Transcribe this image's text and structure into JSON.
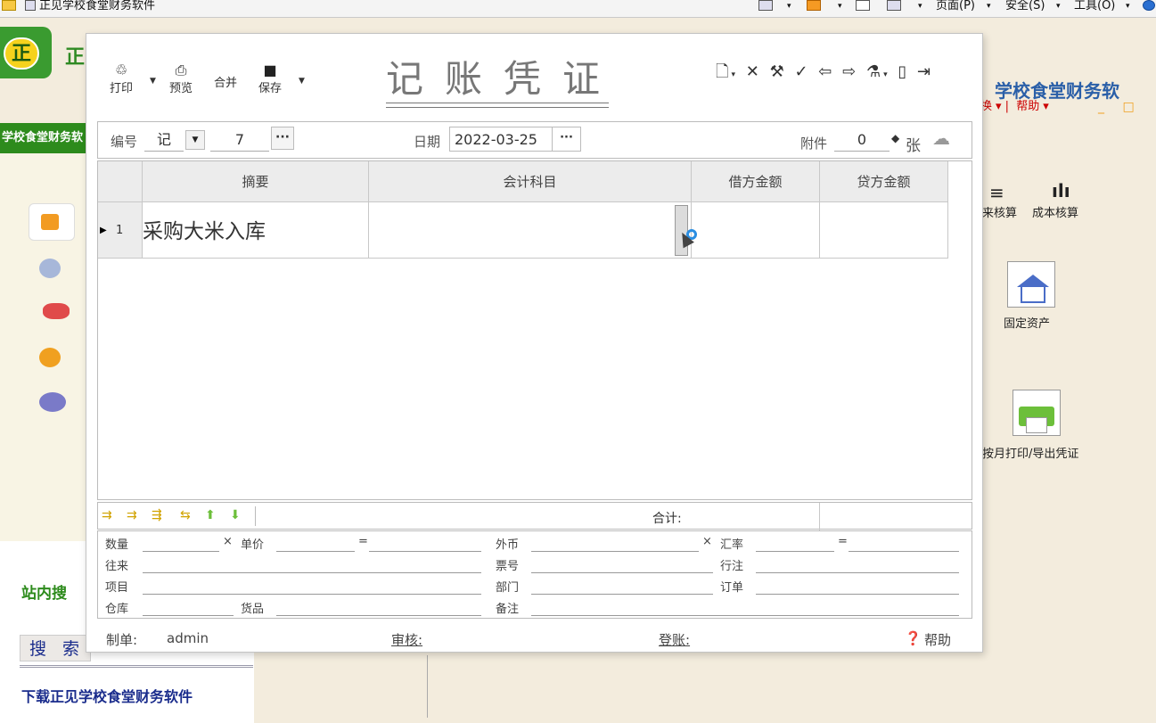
{
  "browser": {
    "tab_title": "正见学校食堂财务软件",
    "page_menu": "页面(P)",
    "safety_menu": "安全(S)",
    "tools_menu": "工具(O)"
  },
  "background": {
    "logo_char": "正",
    "logo_text": "正",
    "nav_banner": "学校食堂财务软",
    "right_title": "学校食堂财务软",
    "right_menu_switch": "换",
    "right_menu_help": "帮助",
    "right_item_cost_accounting": "成本核算",
    "right_item_transaction": "来核算",
    "right_item_fixed_assets": "固定资产",
    "right_item_print_export": "按月打印/导出凭证",
    "site_search": "站内搜",
    "search_button": "搜 索",
    "download_link": "下载正见学校食堂财务软件"
  },
  "toolbar": {
    "print": "打印",
    "preview": "预览",
    "merge": "合并",
    "save": "保存"
  },
  "voucher": {
    "title": "记账凭证",
    "number_label": "编号",
    "number_type": "记",
    "number_value": "7",
    "date_label": "日期",
    "date_value": "2022-03-25",
    "attachment_label": "附件",
    "attachment_count": "0",
    "attachment_unit": "张"
  },
  "grid": {
    "columns": [
      "摘要",
      "会计科目",
      "借方金额",
      "贷方金额"
    ],
    "rows": [
      {
        "num": "1",
        "summary": "采购大米入库",
        "account": "",
        "debit": "",
        "credit": ""
      }
    ],
    "total_label": "合计:"
  },
  "extra_fields": {
    "quantity": "数量",
    "times": "×",
    "unit_price": "单价",
    "equals": "=",
    "foreign_currency": "外币",
    "times2": "×",
    "exchange_rate": "汇率",
    "equals2": "=",
    "contact": "往来",
    "ticket_no": "票号",
    "bank": "行注",
    "project": "项目",
    "department": "部门",
    "order": "订单",
    "warehouse": "仓库",
    "goods": "货品",
    "remark": "备注"
  },
  "footer": {
    "maker_label": "制单:",
    "maker_value": "admin",
    "review_label": "审核:",
    "posting_label": "登账:",
    "help": "帮助"
  }
}
